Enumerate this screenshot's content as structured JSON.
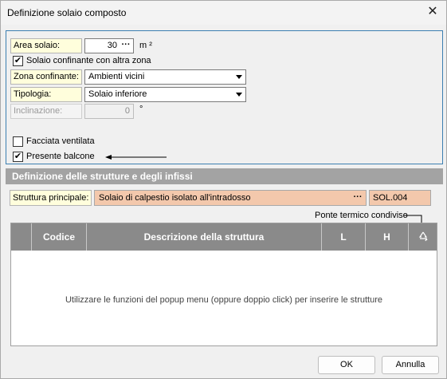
{
  "window": {
    "title": "Definizione solaio composto",
    "close_glyph": "✕"
  },
  "form": {
    "area_label": "Area solaio:",
    "area_value": "30",
    "area_unit": "m ²",
    "dots": "···",
    "confinante_label": "Solaio confinante con altra zona",
    "confinante_checked": "✔",
    "zona_label": "Zona confinante:",
    "zona_value": "Ambienti vicini",
    "tipologia_label": "Tipologia:",
    "tipologia_value": "Solaio inferiore",
    "inclinazione_label": "Inclinazione:",
    "inclinazione_value": "0",
    "inclinazione_unit": "°",
    "facciata_label": "Facciata ventilata",
    "balcone_label": "Presente balcone",
    "balcone_checked": "✔"
  },
  "section": {
    "title": "Definizione delle strutture e degli infissi",
    "struttura_label": "Struttura principale:",
    "struttura_value": "Solaio di calpestio isolato all'intradosso",
    "struttura_code": "SOL.004",
    "ponte_label": "Ponte termico condiviso"
  },
  "table": {
    "columns": [
      "Codice",
      "Descrizione della struttura",
      "L",
      "H"
    ],
    "empty_message": "Utilizzare le funzioni del popup menu (oppure doppio click) per inserire le strutture"
  },
  "buttons": {
    "ok": "OK",
    "cancel": "Annulla"
  }
}
